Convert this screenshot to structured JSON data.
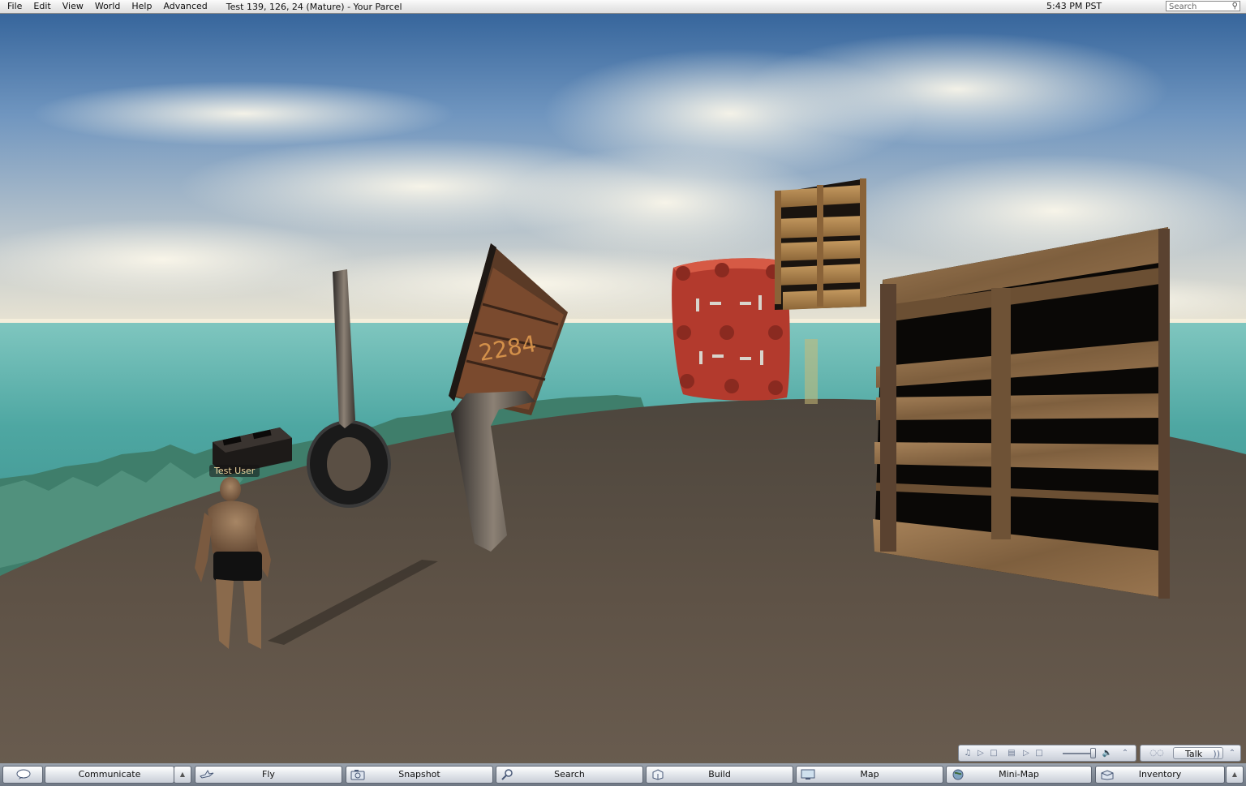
{
  "menubar": {
    "items": [
      "File",
      "Edit",
      "View",
      "World",
      "Help",
      "Advanced"
    ],
    "location": "Test 139, 126, 24 (Mature) - Your Parcel",
    "time": "5:43 PM PST",
    "search_placeholder": "Search"
  },
  "viewport": {
    "avatar_name": "Test User"
  },
  "voice": {
    "talk_label": "Talk"
  },
  "toolbar": {
    "communicate": "Communicate",
    "fly": "Fly",
    "snapshot": "Snapshot",
    "search": "Search",
    "build": "Build",
    "map": "Map",
    "minimap": "Mini-Map",
    "inventory": "Inventory"
  },
  "colors": {
    "sky_top": "#3a6fa8",
    "sea": "#4aa3a0",
    "ground": "#5b5044",
    "red_pallet": "#b8382c",
    "wood": "#8a6a45"
  }
}
